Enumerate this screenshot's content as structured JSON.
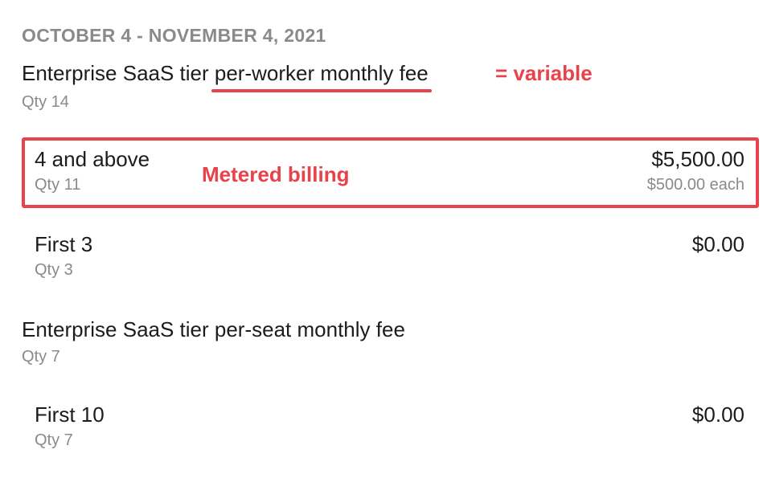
{
  "period": "OCTOBER 4 - NOVEMBER 4, 2021",
  "products": [
    {
      "title_prefix": "Enterprise SaaS tier ",
      "title_highlight": "per-worker monthly fee",
      "qty": "Qty 14",
      "tiers": [
        {
          "name": "4 and above",
          "qty": "Qty 11",
          "amount": "$5,500.00",
          "unit": "$500.00 each"
        },
        {
          "name": "First 3",
          "qty": "Qty 3",
          "amount": "$0.00",
          "unit": ""
        }
      ]
    },
    {
      "title": "Enterprise SaaS tier per-seat monthly fee",
      "qty": "Qty 7",
      "tiers": [
        {
          "name": "First 10",
          "qty": "Qty 7",
          "amount": "$0.00",
          "unit": ""
        }
      ]
    }
  ],
  "annotations": {
    "variable": "= variable",
    "metered": "Metered billing"
  },
  "colors": {
    "annotation_red": "#e8424a",
    "muted_text": "#8a8a8a",
    "primary_text": "#1c1c1c"
  }
}
